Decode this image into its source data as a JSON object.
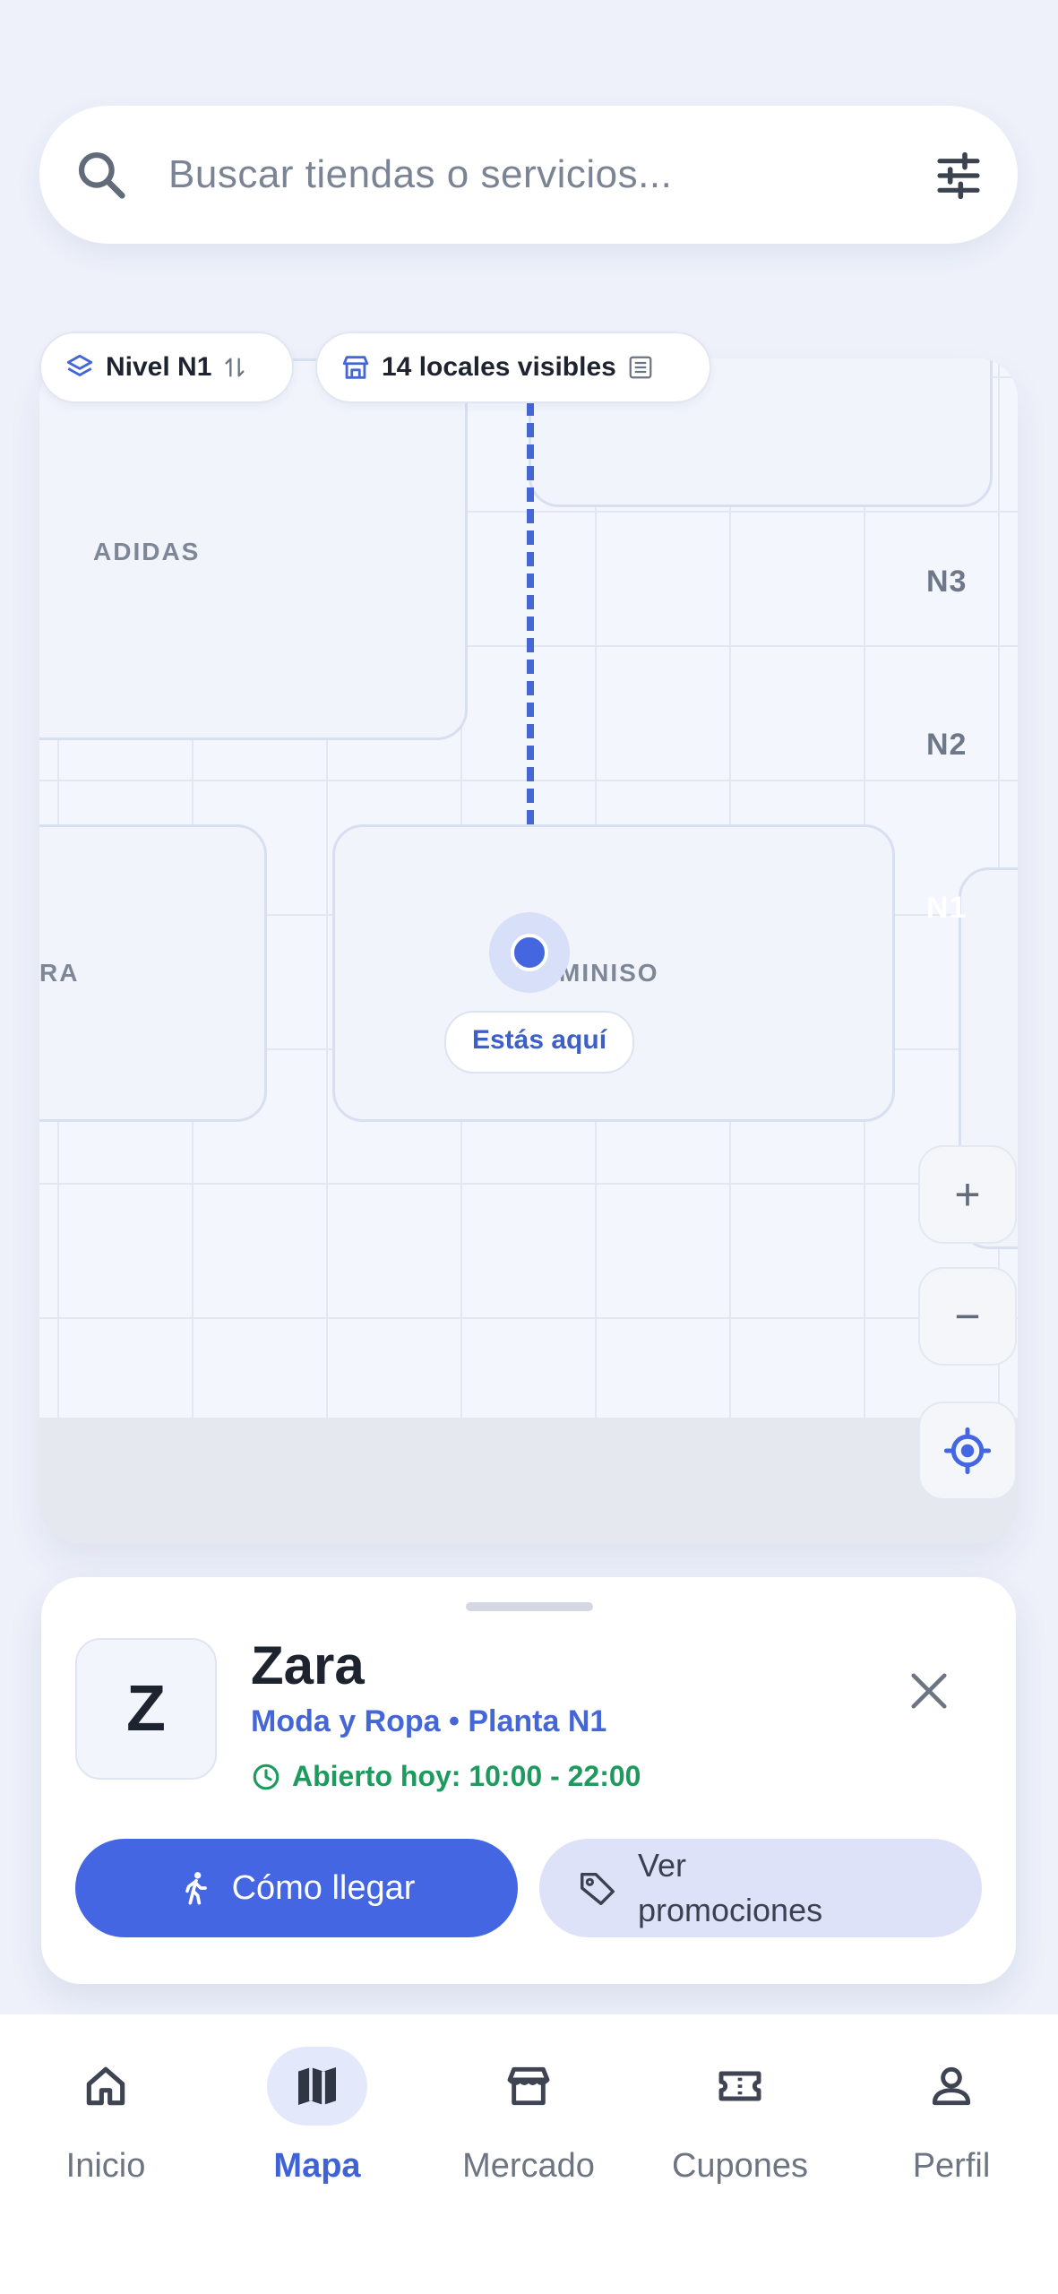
{
  "search": {
    "placeholder": "Buscar tiendas o servicios..."
  },
  "map": {
    "level_chip": "Nivel N1",
    "visible_chip": "14 locales visibles",
    "stores": [
      "ADIDAS",
      "RA",
      "MINISO"
    ],
    "levels": [
      "N3",
      "N2",
      "N1"
    ],
    "you_are_here": "Estás aquí",
    "zoom_in": "+",
    "zoom_out": "−"
  },
  "store_sheet": {
    "logo_letter": "Z",
    "name": "Zara",
    "category": "Moda y Ropa • Planta N1",
    "hours": "Abierto hoy: 10:00 - 22:00",
    "directions_label": "Cómo llegar",
    "promos_label": "Ver promociones"
  },
  "nav": {
    "items": [
      {
        "label": "Inicio",
        "icon": "home-icon"
      },
      {
        "label": "Mapa",
        "icon": "map-icon",
        "active": true
      },
      {
        "label": "Mercado",
        "icon": "store-icon"
      },
      {
        "label": "Cupones",
        "icon": "ticket-icon"
      },
      {
        "label": "Perfil",
        "icon": "person-icon"
      }
    ]
  },
  "colors": {
    "accent": "#4466e2",
    "open": "#1e9a5e",
    "background": "#eef1fa"
  }
}
